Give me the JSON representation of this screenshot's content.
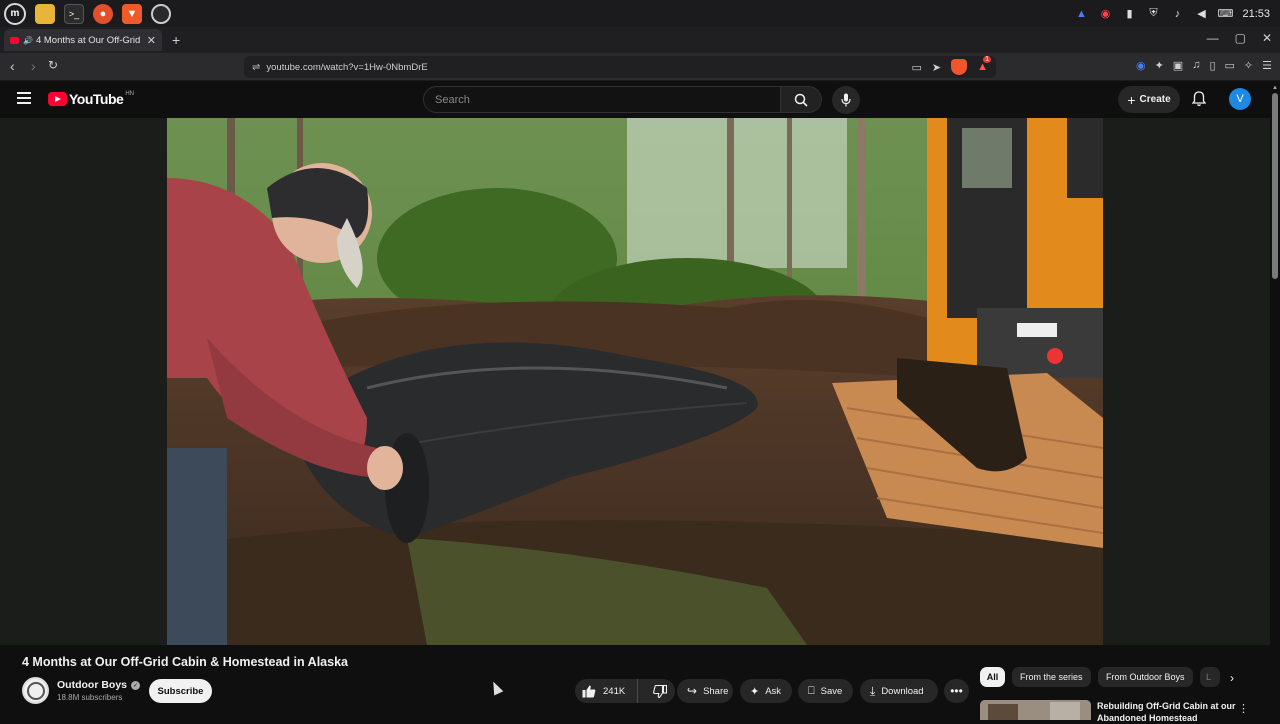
{
  "os": {
    "launcher": "m",
    "time": "21:53"
  },
  "browser": {
    "tab_title": "4 Months at Our Off-Grid",
    "url": "youtube.com/watch?v=1Hw-0NbmDrE",
    "new_tab": "+",
    "brave_badge": "1"
  },
  "youtube": {
    "logo_text": "YouTube",
    "region": "HN",
    "search_placeholder": "Search",
    "create_label": "Create",
    "avatar_letter": "V"
  },
  "video": {
    "title": "4 Months at Our Off-Grid Cabin & Homestead in Alaska",
    "channel": "Outdoor Boys",
    "subscribers": "18.8M subscribers",
    "subscribe_label": "Subscribe",
    "likes": "241K",
    "actions": {
      "share": "Share",
      "ask": "Ask",
      "save": "Save",
      "download": "Download"
    }
  },
  "recommendations": {
    "chips": [
      "All",
      "From the series",
      "From Outdoor Boys",
      "L"
    ],
    "active_chip": "All",
    "first_title": "Rebuilding Off-Grid Cabin at our Abandoned Homestead"
  },
  "colors": {
    "yt_red": "#ff0033",
    "background": "#0f0f0f",
    "avatar_blue": "#1e88e5"
  }
}
